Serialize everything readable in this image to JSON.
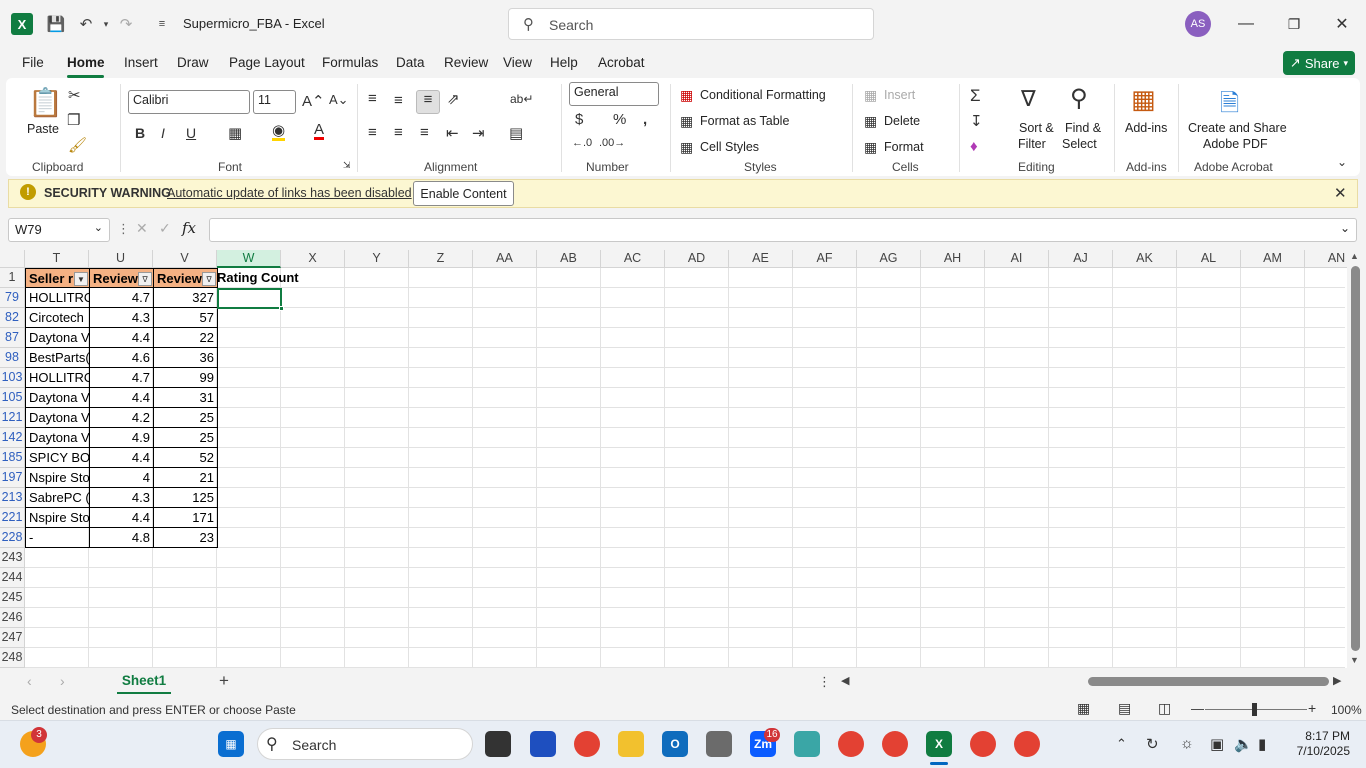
{
  "titlebar": {
    "doc_title": "Supermicro_FBA  -  Excel",
    "search_placeholder": "Search",
    "avatar_initials": "AS"
  },
  "menu": {
    "tabs": [
      "File",
      "Home",
      "Insert",
      "Draw",
      "Page Layout",
      "Formulas",
      "Data",
      "Review",
      "View",
      "Help",
      "Acrobat"
    ],
    "active": "Home",
    "share_label": "Share"
  },
  "ribbon": {
    "clipboard": {
      "paste": "Paste",
      "label": "Clipboard"
    },
    "font": {
      "name": "Calibri",
      "size": "11",
      "label": "Font"
    },
    "alignment": {
      "label": "Alignment"
    },
    "number": {
      "format": "General",
      "label": "Number"
    },
    "styles": {
      "conditional": "Conditional Formatting",
      "format_table": "Format as Table",
      "cell_styles": "Cell Styles",
      "label": "Styles"
    },
    "cells": {
      "insert": "Insert",
      "delete": "Delete",
      "format": "Format",
      "label": "Cells"
    },
    "editing": {
      "sort": "Sort &",
      "filter": "Filter",
      "find": "Find &",
      "select": "Select",
      "label": "Editing"
    },
    "addins": {
      "btn": "Add-ins",
      "label": "Add-ins"
    },
    "acrobat": {
      "line1": "Create and Share",
      "line2": "Adobe PDF",
      "label": "Adobe Acrobat"
    }
  },
  "security": {
    "title": "SECURITY WARNING",
    "message": "Automatic update of links has been disabled",
    "button": "Enable Content"
  },
  "formula_bar": {
    "namebox": "W79",
    "fx": "fx",
    "value": ""
  },
  "columns": [
    "T",
    "U",
    "V",
    "W",
    "X",
    "Y",
    "Z",
    "AA",
    "AB",
    "AC",
    "AD",
    "AE",
    "AF",
    "AG",
    "AH",
    "AI",
    "AJ",
    "AK",
    "AL",
    "AM",
    "AN"
  ],
  "selected_column": "W",
  "header_row": {
    "row": "1",
    "t": "Seller r",
    "u": "Review",
    "v": "Review",
    "w": "Rating Count"
  },
  "rows": [
    {
      "num": "79",
      "t": "HOLLITRO",
      "u": "4.7",
      "v": "327"
    },
    {
      "num": "82",
      "t": "Circotech",
      "u": "4.3",
      "v": "57"
    },
    {
      "num": "87",
      "t": "Daytona V",
      "u": "4.4",
      "v": "22"
    },
    {
      "num": "98",
      "t": "BestParts(",
      "u": "4.6",
      "v": "36"
    },
    {
      "num": "103",
      "t": "HOLLITRO",
      "u": "4.7",
      "v": "99"
    },
    {
      "num": "105",
      "t": "Daytona V",
      "u": "4.4",
      "v": "31"
    },
    {
      "num": "121",
      "t": "Daytona V",
      "u": "4.2",
      "v": "25"
    },
    {
      "num": "142",
      "t": "Daytona V",
      "u": "4.9",
      "v": "25"
    },
    {
      "num": "185",
      "t": "SPICY BON",
      "u": "4.4",
      "v": "52"
    },
    {
      "num": "197",
      "t": "Nspire Sto",
      "u": "4",
      "v": "21"
    },
    {
      "num": "213",
      "t": "SabrePC (S",
      "u": "4.3",
      "v": "125"
    },
    {
      "num": "221",
      "t": "Nspire Sto",
      "u": "4.4",
      "v": "171"
    },
    {
      "num": "228",
      "t": "-",
      "u": "4.8",
      "v": "23"
    }
  ],
  "empty_rows": [
    "243",
    "244",
    "245",
    "246",
    "247",
    "248"
  ],
  "sheet_tab": "Sheet1",
  "status": {
    "text": "Select destination and press ENTER or choose Paste",
    "zoom": "100%"
  },
  "taskbar": {
    "search_placeholder": "Search",
    "time": "8:17 PM",
    "date": "7/10/2025",
    "badge_left": "3",
    "badge_zoom": "16"
  }
}
